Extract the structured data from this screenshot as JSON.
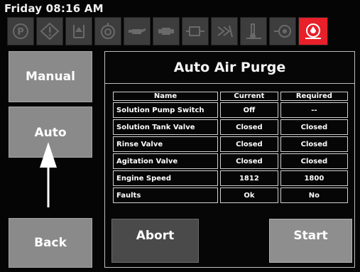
{
  "header": {
    "clock": "Friday 08:16 AM"
  },
  "indicators": [
    {
      "icon": "parking-brake-icon"
    },
    {
      "icon": "warning-icon"
    },
    {
      "icon": "fluid-level-icon"
    },
    {
      "icon": "oil-pressure-icon"
    },
    {
      "icon": "oil-can-icon"
    },
    {
      "icon": "engine-oil-icon"
    },
    {
      "icon": "engine-check-icon"
    },
    {
      "icon": "fan-icon"
    },
    {
      "icon": "coolant-temp-icon"
    },
    {
      "icon": "pump-icon"
    },
    {
      "icon": "water-level-alert-icon",
      "active": true,
      "color": "#e8202a"
    }
  ],
  "side": {
    "manual": "Manual",
    "auto": "Auto",
    "back": "Back"
  },
  "panel": {
    "title": "Auto Air Purge",
    "columns": [
      "Name",
      "Current",
      "Required"
    ],
    "rows": [
      {
        "name": "Solution Pump Switch",
        "current": "Off",
        "required": "--"
      },
      {
        "name": "Solution Tank Valve",
        "current": "Closed",
        "required": "Closed"
      },
      {
        "name": "Rinse Valve",
        "current": "Closed",
        "required": "Closed"
      },
      {
        "name": "Agitation Valve",
        "current": "Closed",
        "required": "Closed"
      },
      {
        "name": "Engine Speed",
        "current": "1812",
        "required": "1800"
      },
      {
        "name": "Faults",
        "current": "Ok",
        "required": "No"
      }
    ],
    "abort": "Abort",
    "start": "Start"
  }
}
